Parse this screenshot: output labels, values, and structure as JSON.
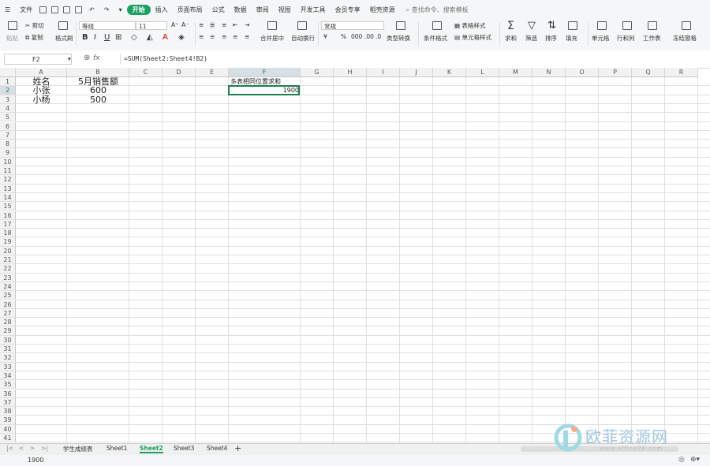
{
  "menu": {
    "file": "文件",
    "tabs": [
      "开始",
      "插入",
      "页面布局",
      "公式",
      "数据",
      "审阅",
      "视图",
      "开发工具",
      "会员专享",
      "稻壳资源"
    ],
    "active_tab": "开始",
    "search": "查找命令、搜索模板"
  },
  "ribbon": {
    "paste": "粘贴",
    "cut": "剪切",
    "copy": "复制",
    "format_painter": "格式刷",
    "font_name": "等线",
    "font_size": "11",
    "bold": "B",
    "italic": "I",
    "underline": "U",
    "merge": "合并居中",
    "wrap": "自动换行",
    "number_format": "常规",
    "currency": "¥",
    "percent": "%",
    "thousands": "000",
    "dec_inc": ".00",
    "dec_dec": ".0",
    "type_convert": "类型转换",
    "cond_format": "条件格式",
    "table_style": "表格样式",
    "cell_style": "单元格样式",
    "sum": "求和",
    "filter": "筛选",
    "sort": "排序",
    "fill": "填充",
    "cell": "单元格",
    "rowcol": "行和列",
    "sheet": "工作表",
    "freeze": "冻结窗格"
  },
  "formula": {
    "name_box": "F2",
    "fx": "fx",
    "content": "=SUM(Sheet2:Sheet4!B2)"
  },
  "columns": [
    "A",
    "B",
    "C",
    "D",
    "E",
    "F",
    "G",
    "H",
    "I",
    "J",
    "K",
    "L",
    "M",
    "N",
    "O",
    "P",
    "Q",
    "R"
  ],
  "rows": [
    "1",
    "2",
    "3",
    "4",
    "5",
    "6",
    "7",
    "8",
    "9",
    "10",
    "11",
    "12",
    "13",
    "14",
    "15",
    "16",
    "17",
    "18",
    "19",
    "20",
    "21",
    "22",
    "23",
    "24",
    "25",
    "26",
    "27",
    "28",
    "29",
    "30",
    "31",
    "32",
    "33",
    "34",
    "35",
    "36",
    "37",
    "38",
    "39",
    "40",
    "41"
  ],
  "cells": {
    "A1": "姓名",
    "B1": "5月销售额",
    "A2": "小张",
    "B2": "600",
    "A3": "小杨",
    "B3": "500",
    "F1": "多表相同位置求和",
    "F2": "1900"
  },
  "sheets": [
    "学生成绩表",
    "Sheet1",
    "Sheet2",
    "Sheet3",
    "Sheet4"
  ],
  "active_sheet": "Sheet2",
  "add_sheet": "+",
  "status_value": "1900",
  "watermark": {
    "text": "欧菲资源网",
    "url": "www.office26.com"
  },
  "colors": {
    "accent": "#1aa15f",
    "selection": "#1a7f4f",
    "grid": "#e0e0e0"
  }
}
